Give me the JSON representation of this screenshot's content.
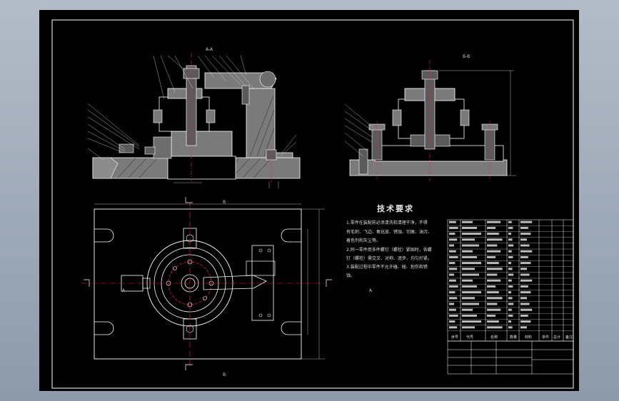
{
  "technical_requirements": {
    "title": "技术要求",
    "lines": [
      "1.零件在装配前必须清洗和清理干净，不得",
      "有毛刺、飞边、氧化皮、锈蚀、切屑、油污、",
      "着色剂和灰尘等。",
      "2.同一零件用多件螺钉（螺栓）紧固时，各螺",
      "钉（螺栓）需交叉、对称、逐步、均匀拧紧。",
      "3.装配过程中零件不允许磕、碰、划伤和锈",
      "蚀。"
    ]
  },
  "section_labels": {
    "front": "A-A",
    "side": "B-B",
    "cut_b": "B",
    "cut_a": "A"
  },
  "bom_headers": [
    "序号",
    "代号",
    "名称",
    "数量",
    "材料",
    "单件",
    "总计",
    "备注"
  ],
  "colors": {
    "background": "#000000",
    "outline": "#ffffff",
    "centerline": "#ff2020",
    "thread": "#d02020",
    "fill": "#7a7a7a",
    "ui_chrome": "#9aa6b5"
  }
}
